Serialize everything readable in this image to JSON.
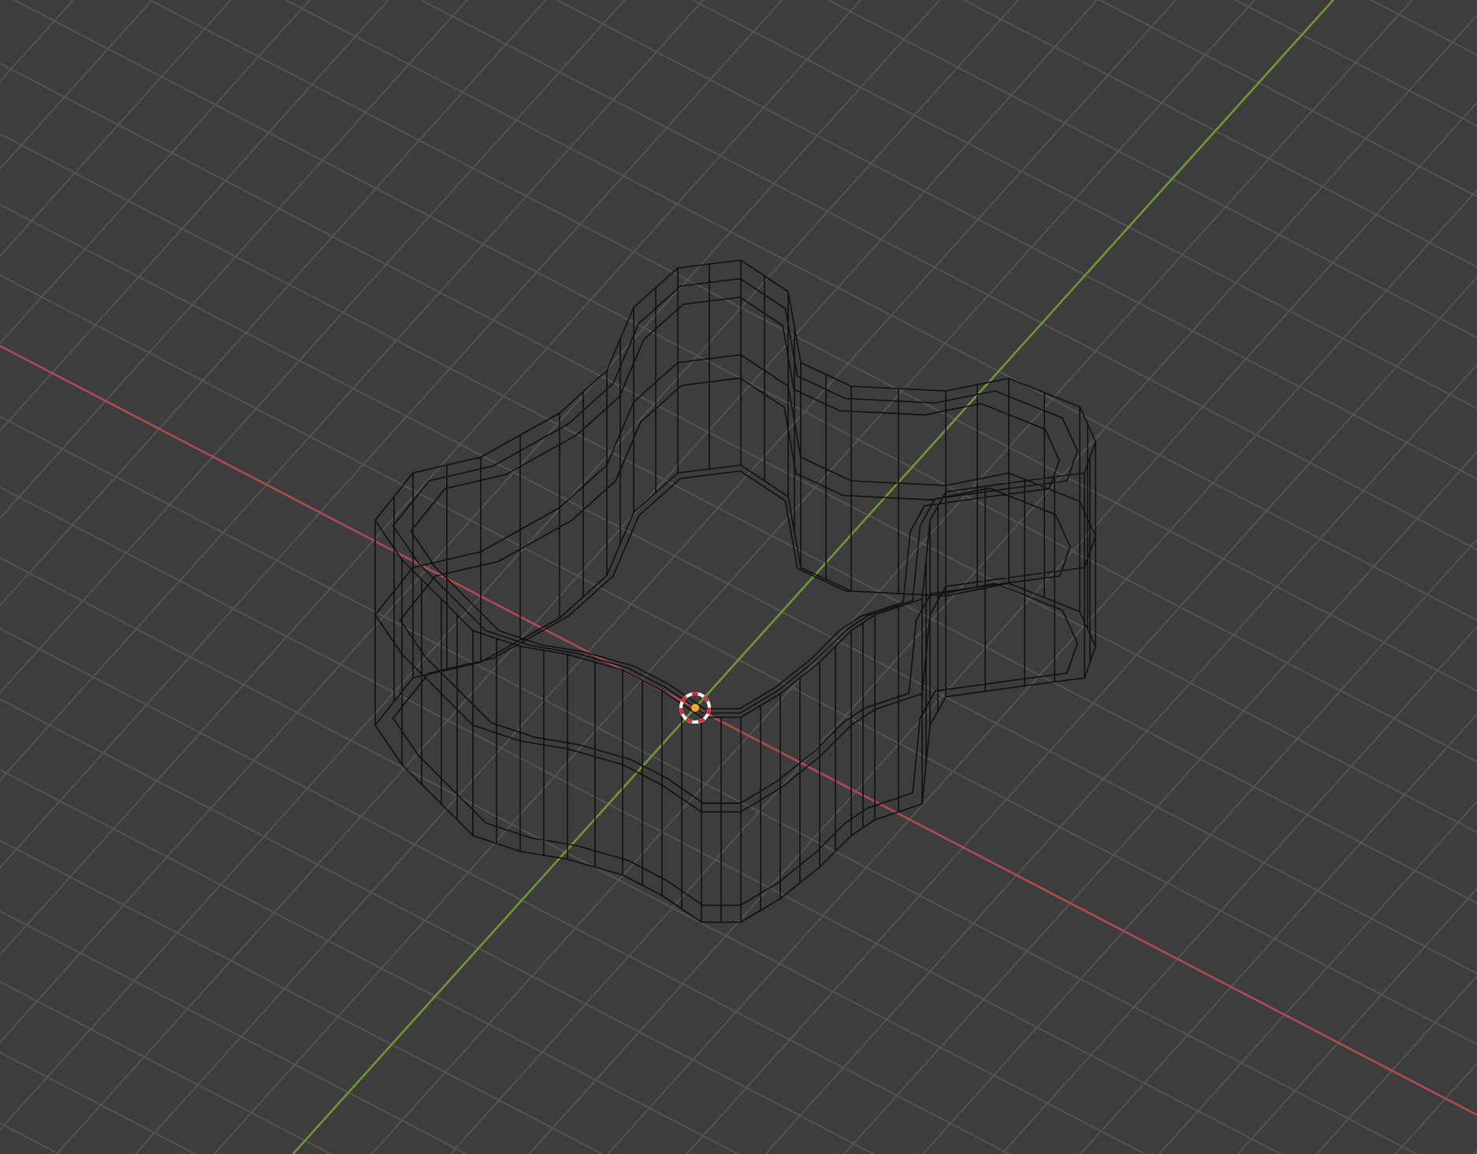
{
  "viewport": {
    "wireframe": true,
    "show_grid": true,
    "show_axes": true,
    "show_cursor": true
  }
}
